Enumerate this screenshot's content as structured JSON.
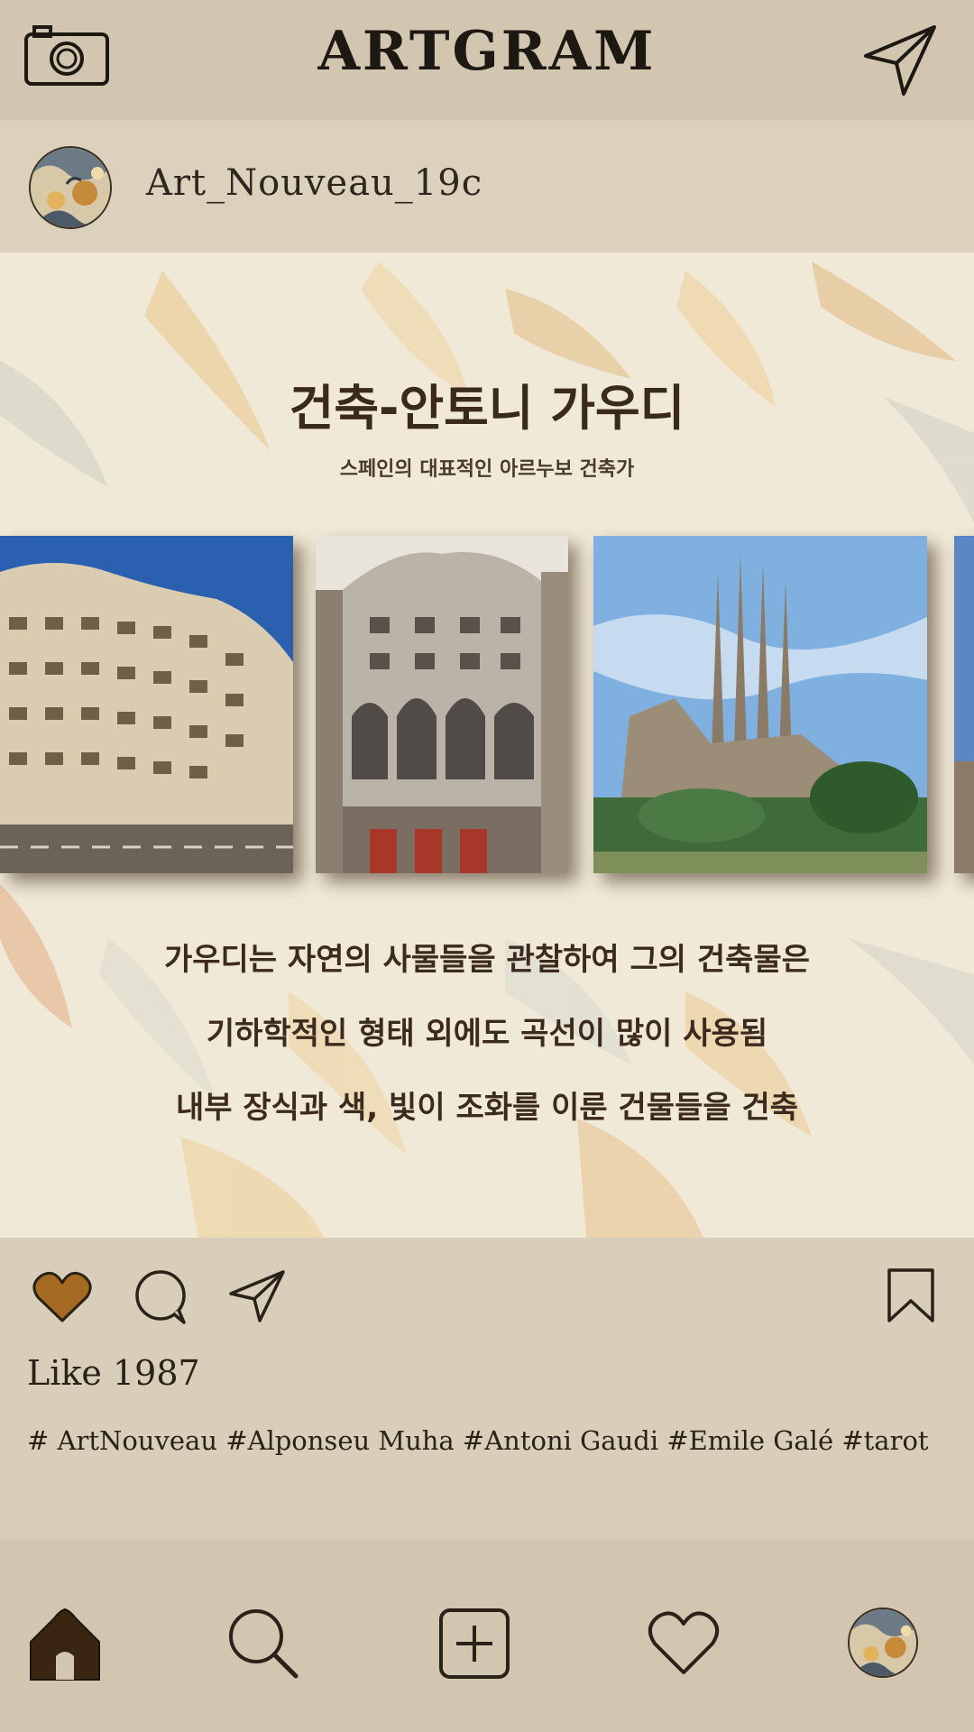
{
  "app": {
    "title": "ARTGRAM"
  },
  "post": {
    "username": "Art_Nouveau_19c",
    "heading": "건축-안토니 가우디",
    "subheading": "스페인의 대표적인 아르누보 건축가",
    "lines": [
      "가우디는 자연의 사물들을 관찰하여 그의 건축물은",
      "기하학적인 형태 외에도 곡선이 많이 사용됨",
      "내부 장식과 색, 빛이 조화를 이룬 건물들을 건축"
    ]
  },
  "engagement": {
    "likes_text": "Like  1987",
    "hashtags": "# ArtNouveau #Alponseu Muha #Antoni Gaudi #Emile Galé #tarot"
  },
  "icons": {
    "camera": "camera-icon",
    "send": "paper-plane-icon",
    "heart": "heart-icon",
    "comment": "comment-icon",
    "share": "share-icon",
    "bookmark": "bookmark-icon",
    "home": "home-icon",
    "search": "search-icon",
    "add": "add-icon",
    "activity": "heart-outline-icon",
    "profile": "profile-avatar"
  },
  "colors": {
    "bar": "#d2c6b0",
    "liked_heart": "#a56a21",
    "text": "#2a2118"
  }
}
